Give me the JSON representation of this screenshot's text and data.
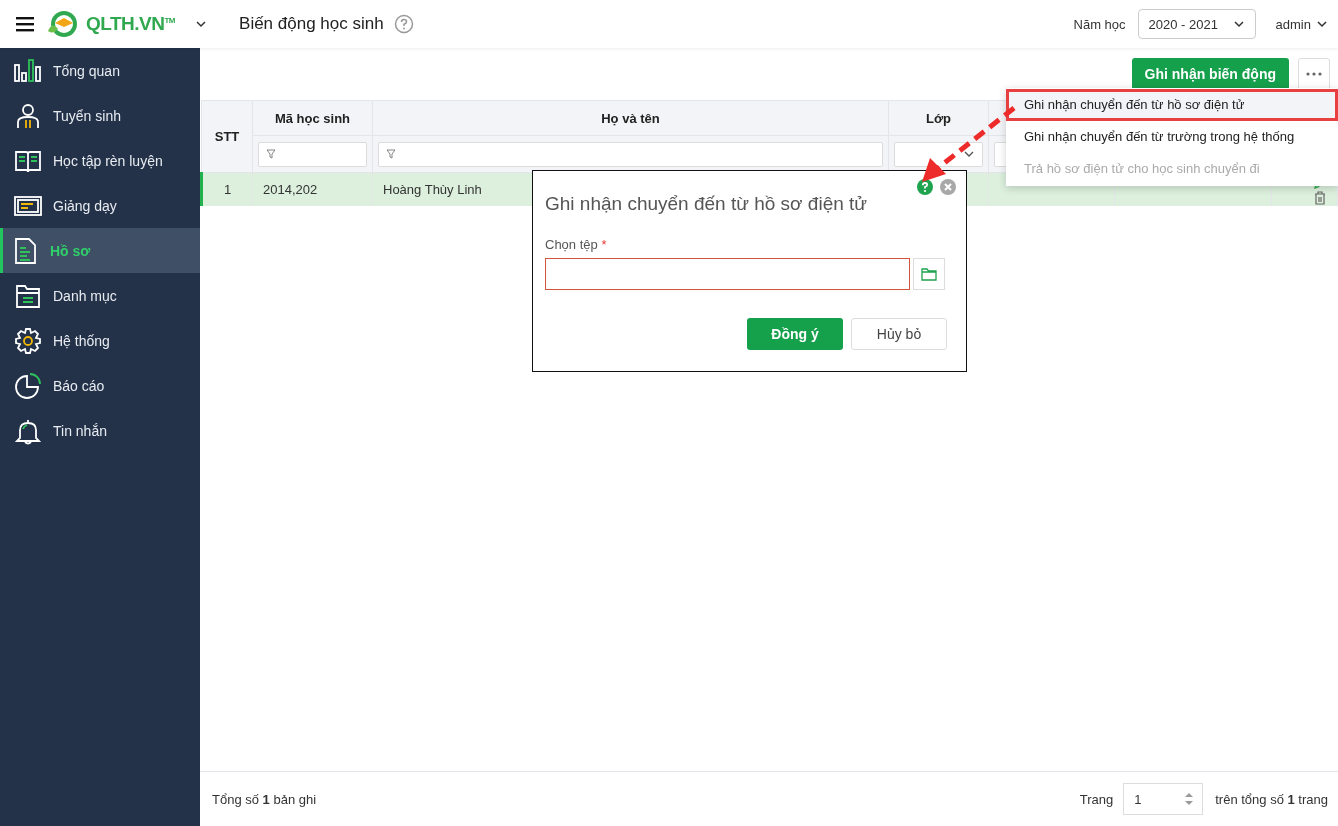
{
  "header": {
    "logo": "QLTH.VN",
    "trademark": "TM",
    "page_title": "Biến động học sinh",
    "year_label": "Năm học",
    "year_value": "2020 - 2021",
    "user": "admin"
  },
  "sidebar": {
    "items": [
      {
        "label": "Tổng quan",
        "kind": "chart",
        "selected": false
      },
      {
        "label": "Tuyển sinh",
        "kind": "person",
        "selected": false
      },
      {
        "label": "Học tập rèn luyện",
        "kind": "book",
        "selected": false
      },
      {
        "label": "Giảng dạy",
        "kind": "board",
        "selected": false
      },
      {
        "label": "Hồ sơ",
        "kind": "file",
        "selected": true
      },
      {
        "label": "Danh mục",
        "kind": "folder",
        "selected": false
      },
      {
        "label": "Hệ thống",
        "kind": "gear",
        "selected": false
      },
      {
        "label": "Báo cáo",
        "kind": "pie",
        "selected": false
      },
      {
        "label": "Tin nhắn",
        "kind": "bell",
        "selected": false
      }
    ]
  },
  "toolbar": {
    "primary_button": "Ghi nhận biến động"
  },
  "table": {
    "columns": [
      {
        "label": "STT",
        "kind": "plain"
      },
      {
        "label": "Mã học sinh",
        "kind": "text"
      },
      {
        "label": "Họ và tên",
        "kind": "text"
      },
      {
        "label": "Lớp",
        "kind": "select"
      }
    ],
    "rows": [
      {
        "cells": [
          "1",
          "2014,202",
          "Hoàng Thùy Linh"
        ],
        "selected": true
      }
    ]
  },
  "dropdown": {
    "items": [
      {
        "label": "Ghi nhận chuyển đến từ hồ sơ điện tử",
        "disabled": false,
        "highlighted": true
      },
      {
        "label": "Ghi nhận chuyển đến từ trường trong hệ thống",
        "disabled": false,
        "highlighted": false
      },
      {
        "label": "Trả hồ sơ điện tử cho học sinh chuyển đi",
        "disabled": true,
        "highlighted": false
      }
    ]
  },
  "dialog": {
    "title": "Ghi nhận chuyển đến từ hồ sơ điện tử",
    "field_label": "Chọn tệp",
    "required_mark": "*",
    "confirm_button": "Đồng ý",
    "cancel_button": "Hủy bỏ"
  },
  "footer": {
    "total": "Tổng số **1** bản ghi",
    "page_label": "Trang",
    "page_value": "1",
    "page_total": "trên tổng số **1** trang"
  }
}
